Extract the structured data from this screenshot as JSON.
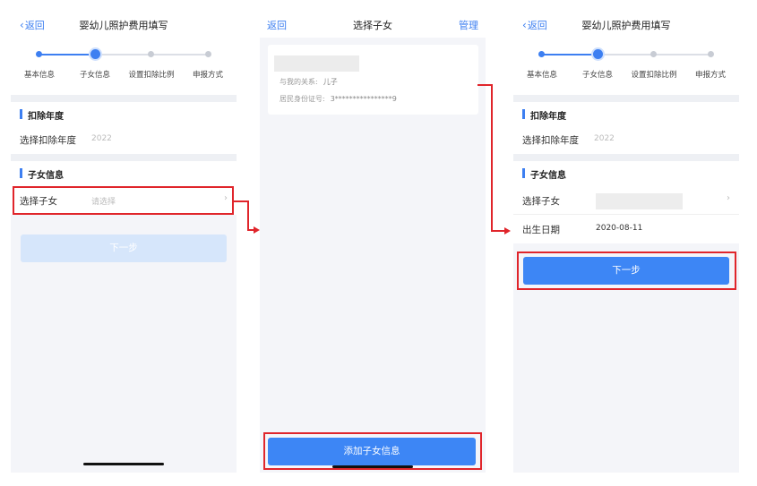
{
  "colors": {
    "accent": "#3d7ff1",
    "highlight": "#e0252b",
    "button": "#3d86f5",
    "button_disabled": "#d6e6fb"
  },
  "common": {
    "back_label": "返回",
    "steps": [
      "基本信息",
      "子女信息",
      "设置扣除比例",
      "申报方式"
    ]
  },
  "screen1": {
    "title": "婴幼儿照护费用填写",
    "section_year": "扣除年度",
    "year_label": "选择扣除年度",
    "year_value": "2022",
    "section_child": "子女信息",
    "child_label": "选择子女",
    "child_placeholder": "请选择",
    "next_label": "下一步"
  },
  "screen2": {
    "title": "选择子女",
    "manage_label": "管理",
    "relation_label": "与我的关系:",
    "relation_value": "儿子",
    "id_label": "居民身份证号:",
    "id_value": "3****************9",
    "add_label": "添加子女信息"
  },
  "screen3": {
    "title": "婴幼儿照护费用填写",
    "section_year": "扣除年度",
    "year_label": "选择扣除年度",
    "year_value": "2022",
    "section_child": "子女信息",
    "child_label": "选择子女",
    "birth_label": "出生日期",
    "birth_value": "2020-08-11",
    "next_label": "下一步"
  }
}
